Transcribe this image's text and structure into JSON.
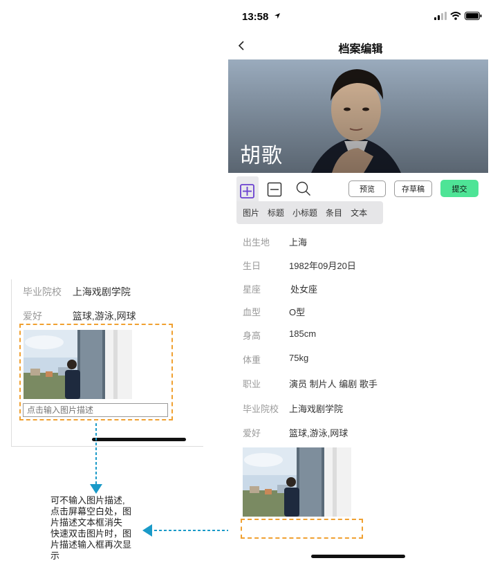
{
  "status_bar": {
    "time": "13:58"
  },
  "nav": {
    "title": "档案编辑"
  },
  "hero": {
    "name": "胡歌"
  },
  "toolbar": {
    "preview_label": "预览",
    "draft_label": "存草稿",
    "submit_label": "提交"
  },
  "insert_menu": [
    "图片",
    "标题",
    "小标题",
    "条目",
    "文本"
  ],
  "profile": [
    {
      "key": "出生地",
      "value": "上海"
    },
    {
      "key": "生日",
      "value": "1982年09月20日"
    },
    {
      "key": "星座",
      "value": "处女座"
    },
    {
      "key": "血型",
      "value": "O型"
    },
    {
      "key": "身高",
      "value": "185cm"
    },
    {
      "key": "体重",
      "value": "75kg"
    },
    {
      "key": "职业",
      "value": "演员 制片人 编剧 歌手"
    },
    {
      "key": "毕业院校",
      "value": "上海戏剧学院"
    },
    {
      "key": "爱好",
      "value": "篮球,游泳,网球"
    }
  ],
  "left_panel": {
    "school_key": "毕业院校",
    "school_value": "上海戏剧学院",
    "hobby_key": "爱好",
    "hobby_value": "篮球,游泳,网球",
    "caption_placeholder": "点击输入图片描述"
  },
  "annotation": {
    "lines": [
      "可不输入图片描述,",
      "点击屏幕空白处，图",
      "片描述文本框消失",
      "快速双击图片时，图",
      "片描述输入框再次显",
      "示"
    ]
  },
  "colors": {
    "accent_dash": "#f0a030",
    "submit_green": "#4ee496",
    "plus_purple": "#6a3fd0",
    "arrow_blue": "#1a9ac8"
  }
}
